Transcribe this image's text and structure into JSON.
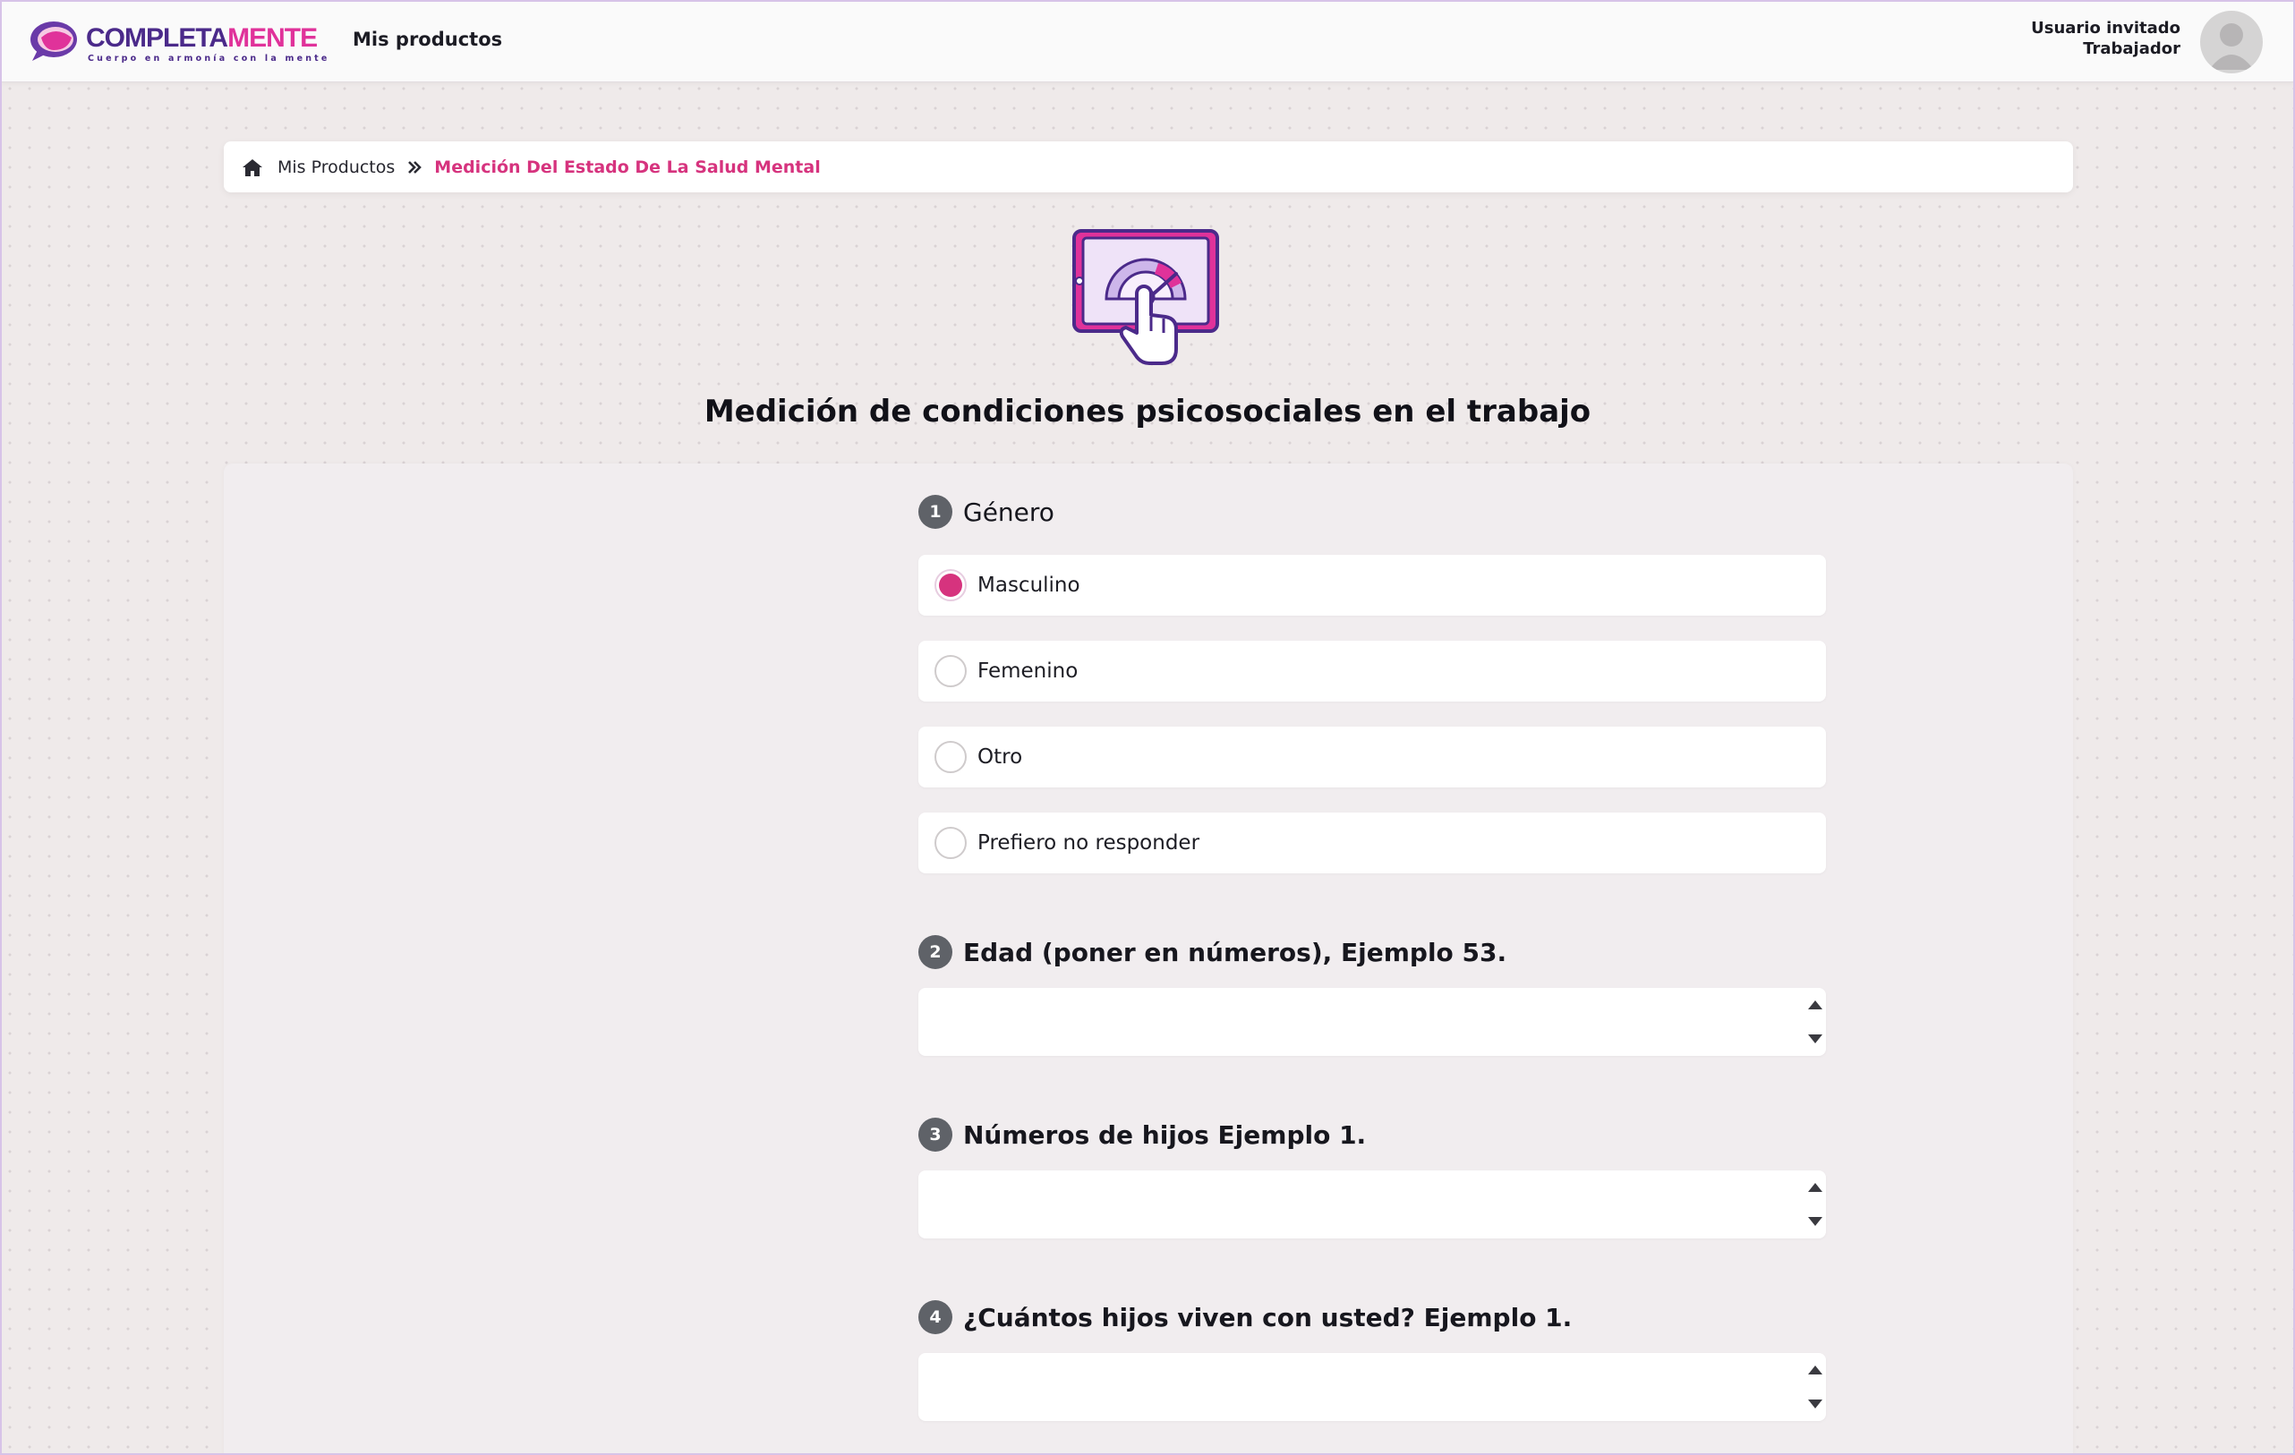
{
  "header": {
    "logo": {
      "brand_part1": "COMPLETA",
      "brand_part2": "MENTE",
      "tagline": "Cuerpo en armonía con la mente"
    },
    "nav_link": "Mis productos",
    "user": {
      "name": "Usuario invitado",
      "role": "Trabajador"
    }
  },
  "breadcrumb": {
    "items": [
      "Mis Productos",
      "Medición Del Estado De La Salud Mental"
    ]
  },
  "page": {
    "title": "Medición de condiciones psicosociales en el trabajo"
  },
  "questions": [
    {
      "number": "1",
      "label": "Género",
      "type": "radio",
      "options": [
        "Masculino",
        "Femenino",
        "Otro",
        "Prefiero no responder"
      ],
      "selected": "Masculino"
    },
    {
      "number": "2",
      "label": "Edad (poner en números), Ejemplo 53.",
      "type": "number",
      "value": ""
    },
    {
      "number": "3",
      "label": "Números de hijos Ejemplo 1.",
      "type": "number",
      "value": ""
    },
    {
      "number": "4",
      "label": "¿Cuántos hijos viven con usted? Ejemplo 1.",
      "type": "number",
      "value": ""
    }
  ],
  "icons": {
    "home": "home-icon",
    "separator": "double-chevron-right-icon",
    "hero": "tablet-gauge-touch-icon",
    "avatar": "user-avatar"
  },
  "colors": {
    "accent": "#d6337e",
    "brand_purple": "#4b2a8a",
    "badge": "#5f6268"
  }
}
